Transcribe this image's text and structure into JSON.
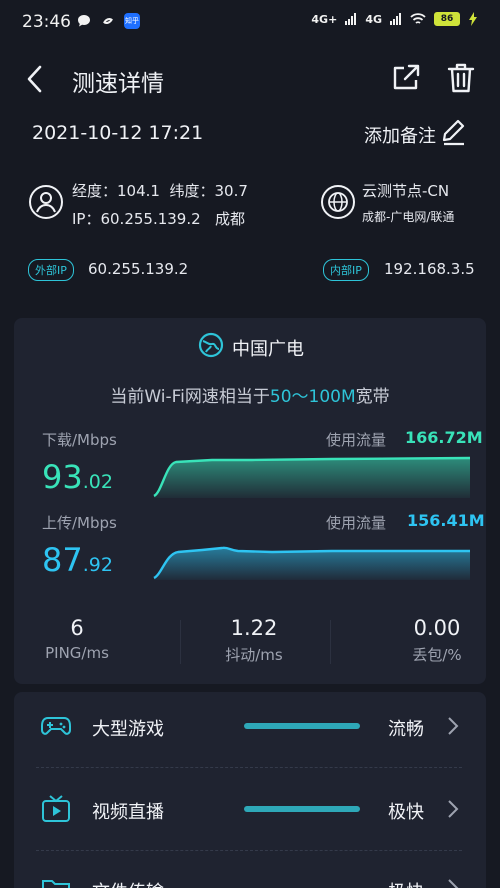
{
  "status_bar": {
    "time": "23:46",
    "net1": "4G+",
    "net2": "4G",
    "battery": "86",
    "badge": "知乎"
  },
  "header": {
    "title": "测速详情"
  },
  "meta": {
    "datetime": "2021-10-12 17:21",
    "add_note": "添加备注"
  },
  "location": {
    "line1": "经度：104.1  纬度：30.7",
    "line2": "IP：60.255.139.2   成都"
  },
  "node": {
    "name": "云测节点-CN",
    "detail": "成都-广电网/联通"
  },
  "ips": {
    "external_label": "外部IP",
    "external": "60.255.139.2",
    "internal_label": "内部IP",
    "internal": "192.168.3.5"
  },
  "result": {
    "isp": "中国广电",
    "equiv_prefix": "当前Wi-Fi网速相当于",
    "equiv_range": "50～100M",
    "equiv_suffix": "宽带",
    "download_label": "下载/Mbps",
    "download_int": "93",
    "download_dec": ".02",
    "usage_label": "使用流量",
    "download_usage": "166.72M",
    "upload_label": "上传/Mbps",
    "upload_int": "87",
    "upload_dec": ".92",
    "upload_usage": "156.41M",
    "colors": {
      "download": "#39e3b9",
      "upload": "#2ec4f2",
      "accent": "#2ec4d8"
    }
  },
  "stats": {
    "ping_value": "6",
    "ping_label": "PING/ms",
    "jitter_value": "1.22",
    "jitter_label": "抖动/ms",
    "loss_value": "0.00",
    "loss_label": "丢包/%"
  },
  "scenarios": [
    {
      "icon": "gamepad-icon",
      "label": "大型游戏",
      "status": "流畅",
      "level": 1.0
    },
    {
      "icon": "tv-icon",
      "label": "视频直播",
      "status": "极快",
      "level": 1.0
    },
    {
      "icon": "folder-icon",
      "label": "文件传输",
      "status": "极快",
      "level": 1.0
    }
  ]
}
